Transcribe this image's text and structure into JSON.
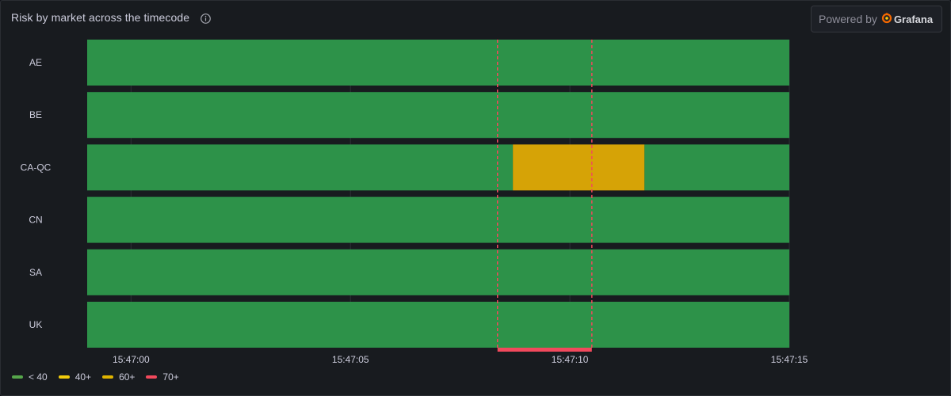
{
  "panel": {
    "title": "Risk by market across the timecode",
    "info_icon": "info-circle-icon"
  },
  "powered_by": {
    "prefix": "Powered by",
    "brand": "Grafana",
    "logo_icon": "grafana-logo-icon"
  },
  "chart_data": {
    "type": "state-timeline",
    "title": "Risk by market across the timecode",
    "rows": [
      "AE",
      "BE",
      "CA-QC",
      "CN",
      "SA",
      "UK"
    ],
    "x_ticks": [
      "15:47:00",
      "15:47:05",
      "15:47:10",
      "15:47:15"
    ],
    "x_range_seconds": [
      -1,
      15
    ],
    "states": [
      {
        "row": "AE",
        "segments": [
          {
            "start": -1,
            "end": 15,
            "state": "< 40"
          }
        ]
      },
      {
        "row": "BE",
        "segments": [
          {
            "start": -1,
            "end": 15,
            "state": "< 40"
          }
        ]
      },
      {
        "row": "CA-QC",
        "segments": [
          {
            "start": -1,
            "end": 8.7,
            "state": "< 40"
          },
          {
            "start": 8.7,
            "end": 11.7,
            "state": "60+"
          },
          {
            "start": 11.7,
            "end": 15,
            "state": "< 40"
          }
        ]
      },
      {
        "row": "CN",
        "segments": [
          {
            "start": -1,
            "end": 15,
            "state": "< 40"
          }
        ]
      },
      {
        "row": "SA",
        "segments": [
          {
            "start": -1,
            "end": 15,
            "state": "< 40"
          }
        ]
      },
      {
        "row": "UK",
        "segments": [
          {
            "start": -1,
            "end": 15,
            "state": "< 40"
          }
        ]
      }
    ],
    "annotation_region": {
      "start": 8.35,
      "end": 10.5,
      "color": "#f2495c"
    },
    "grid": true,
    "legend_placement": "bottom-left",
    "legend": [
      {
        "label": "< 40",
        "color": "#56a64b"
      },
      {
        "label": "40+",
        "color": "#f2cc0c"
      },
      {
        "label": "60+",
        "color": "#e0b400"
      },
      {
        "label": "70+",
        "color": "#f2495c"
      }
    ],
    "fill_colors": {
      "< 40": "#2d9249",
      "40+": "#e0b400",
      "60+": "#d6a306",
      "70+": "#e02f44"
    }
  }
}
